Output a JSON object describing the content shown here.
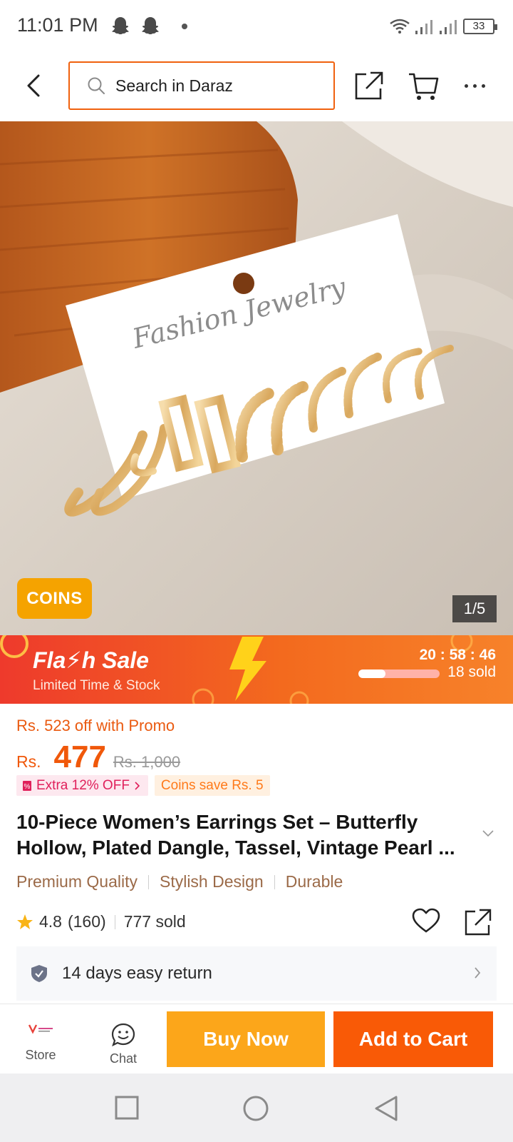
{
  "status_bar": {
    "time": "11:01 PM",
    "battery": "33",
    "icons": [
      "snapchat-ghost-icon",
      "snapchat-ghost-icon",
      "notification-dot",
      "wifi-icon",
      "signal-icon",
      "signal-icon",
      "battery-icon"
    ]
  },
  "top_nav": {
    "search_placeholder": "Search in Daraz",
    "accent": "#f0610e"
  },
  "gallery": {
    "coins_badge": "COINS",
    "page_indicator": "1/5",
    "image_subject": "gold hoop earrings set on a card with script lettering",
    "card_lettering": "Fashion Jewelry"
  },
  "flash_sale": {
    "title": "Fla⚡h Sale",
    "subtitle": "Limited Time & Stock",
    "timer": "20 : 58 : 46",
    "sold": "18 sold",
    "progress": 0.33
  },
  "price": {
    "promo": "Rs. 523 off with Promo",
    "currency": "Rs.",
    "value": "477",
    "old": "Rs. 1,000",
    "accent": "#f0580a"
  },
  "chips": {
    "extra": "Extra 12% OFF",
    "coins": "Coins save Rs. 5"
  },
  "product": {
    "title": "10-Piece Women’s Earrings Set – Butterfly Hollow, Plated Dangle, Tassel, Vintage Pearl ...",
    "highlights": [
      "Premium Quality",
      "Stylish Design",
      "Durable"
    ]
  },
  "rating": {
    "score": "4.8",
    "count": "(160)",
    "sold": "777 sold"
  },
  "return_policy": {
    "text": "14 days easy return"
  },
  "bottom_bar": {
    "store": "Store",
    "chat": "Chat",
    "buy_now": "Buy Now",
    "add_to_cart": "Add to Cart",
    "buy_color": "#fca61a",
    "cart_color": "#f95a06"
  }
}
